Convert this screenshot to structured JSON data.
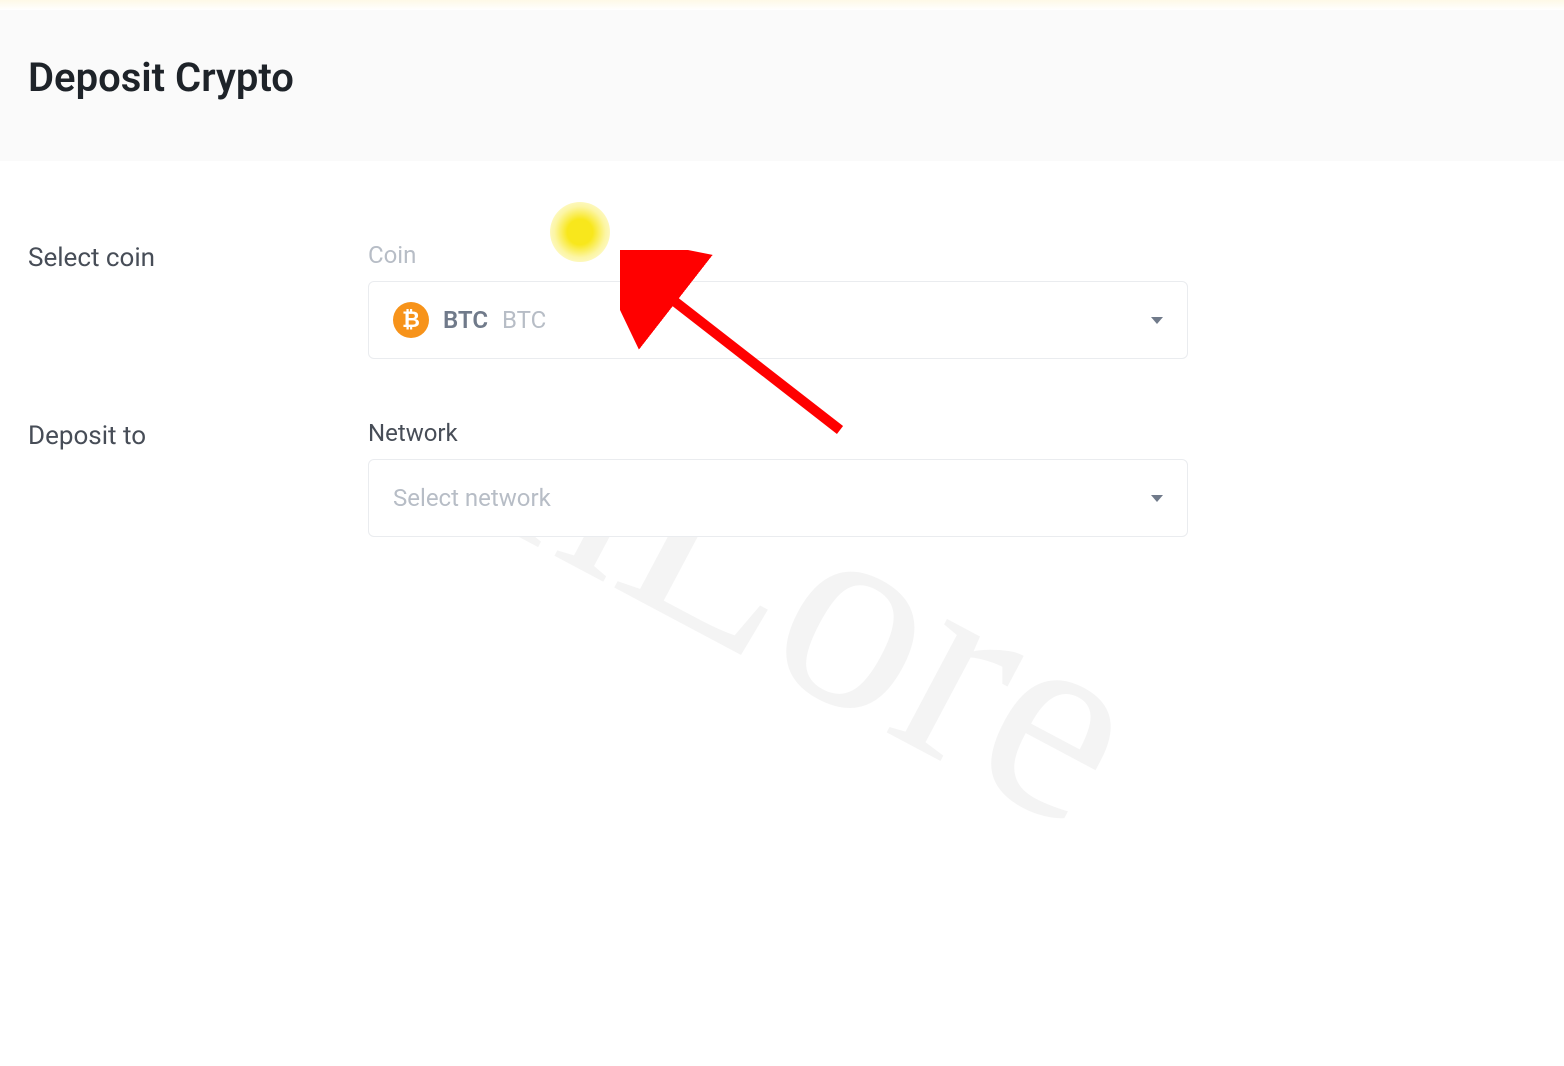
{
  "header": {
    "title": "Deposit Crypto"
  },
  "form": {
    "select_coin": {
      "row_label": "Select coin",
      "field_label": "Coin",
      "selected": {
        "symbol": "BTC",
        "name": "BTC",
        "icon_glyph": "₿",
        "icon_color": "#f7931a"
      }
    },
    "deposit_to": {
      "row_label": "Deposit to",
      "field_label": "Network",
      "placeholder": "Select network"
    }
  },
  "watermark_text": "CoinLore"
}
